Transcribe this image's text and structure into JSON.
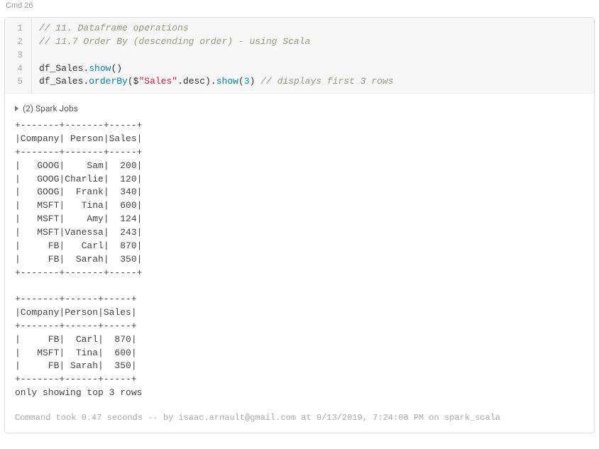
{
  "cell": {
    "header": "Cmd 26",
    "gutter": [
      "1",
      "2",
      "3",
      "4",
      "5"
    ],
    "code": {
      "line1_comment": "// 11. Dataframe operations",
      "line2_comment": "// 11.7 Order By (descending order) - using Scala",
      "line3": "",
      "line4": {
        "obj": "df_Sales",
        "dot1": ".",
        "m1": "show",
        "paren": "()"
      },
      "line5": {
        "obj": "df_Sales",
        "dot1": ".",
        "m1": "orderBy",
        "open": "(",
        "dollar": "$",
        "str": "\"Sales\"",
        "dot2": ".",
        "m2": "desc",
        "close_mid": ").",
        "m3": "show",
        "open2": "(",
        "num": "3",
        "close2": ") ",
        "comment": "// displays first 3 rows"
      }
    },
    "jobs": "(2) Spark Jobs",
    "output_text": "+-------+-------+-----+\n|Company| Person|Sales|\n+-------+-------+-----+\n|   GOOG|    Sam|  200|\n|   GOOG|Charlie|  120|\n|   GOOG|  Frank|  340|\n|   MSFT|   Tina|  600|\n|   MSFT|    Amy|  124|\n|   MSFT|Vanessa|  243|\n|     FB|   Carl|  870|\n|     FB|  Sarah|  350|\n+-------+-------+-----+\n\n+-------+------+-----+\n|Company|Person|Sales|\n+-------+------+-----+\n|     FB|  Carl|  870|\n|   MSFT|  Tina|  600|\n|     FB| Sarah|  350|\n+-------+------+-----+\nonly showing top 3 rows\n",
    "footer": "Command took 0.47 seconds -- by isaac.arnault@gmail.com at 9/13/2019, 7:24:08 PM on spark_scala"
  },
  "chart_data": {
    "type": "table",
    "tables": [
      {
        "title": "df_Sales.show()",
        "columns": [
          "Company",
          "Person",
          "Sales"
        ],
        "rows": [
          [
            "GOOG",
            "Sam",
            200
          ],
          [
            "GOOG",
            "Charlie",
            120
          ],
          [
            "GOOG",
            "Frank",
            340
          ],
          [
            "MSFT",
            "Tina",
            600
          ],
          [
            "MSFT",
            "Amy",
            124
          ],
          [
            "MSFT",
            "Vanessa",
            243
          ],
          [
            "FB",
            "Carl",
            870
          ],
          [
            "FB",
            "Sarah",
            350
          ]
        ]
      },
      {
        "title": "orderBy Sales desc top 3",
        "columns": [
          "Company",
          "Person",
          "Sales"
        ],
        "rows": [
          [
            "FB",
            "Carl",
            870
          ],
          [
            "MSFT",
            "Tina",
            600
          ],
          [
            "FB",
            "Sarah",
            350
          ]
        ],
        "note": "only showing top 3 rows"
      }
    ]
  }
}
